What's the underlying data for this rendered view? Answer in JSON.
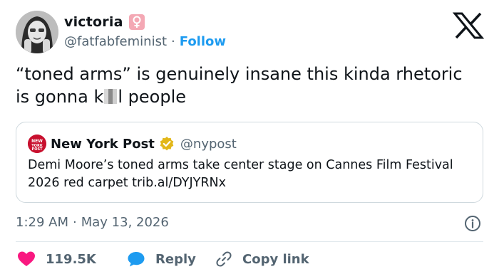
{
  "user": {
    "display_name": "victoria",
    "badge": "venus-icon",
    "handle": "@fatfabfeminist",
    "separator": "·",
    "follow_label": "Follow"
  },
  "tweet": {
    "text_part1": "“toned arms” is genuinely insane this kinda rhetoric is gonna k",
    "text_part2": "l people"
  },
  "quote": {
    "display_name": "New York Post",
    "handle": "@nypost",
    "logo_text": "NEW YORK POST",
    "text": "Demi Moore’s toned arms take center stage on Cannes Film Festival 2026 red carpet trib.al/DYJYRNx"
  },
  "meta": {
    "time": "1:29 AM",
    "separator": "·",
    "date": "May 13, 2026"
  },
  "actions": {
    "like_count": "119.5K",
    "reply_label": "Reply",
    "copy_label": "Copy link"
  },
  "colors": {
    "like": "#f91880",
    "reply": "#1d9bf0",
    "link": "#1d9bf0",
    "muted": "#536471",
    "nypost_red": "#c8102e",
    "verified_gold": "#e2b719"
  }
}
